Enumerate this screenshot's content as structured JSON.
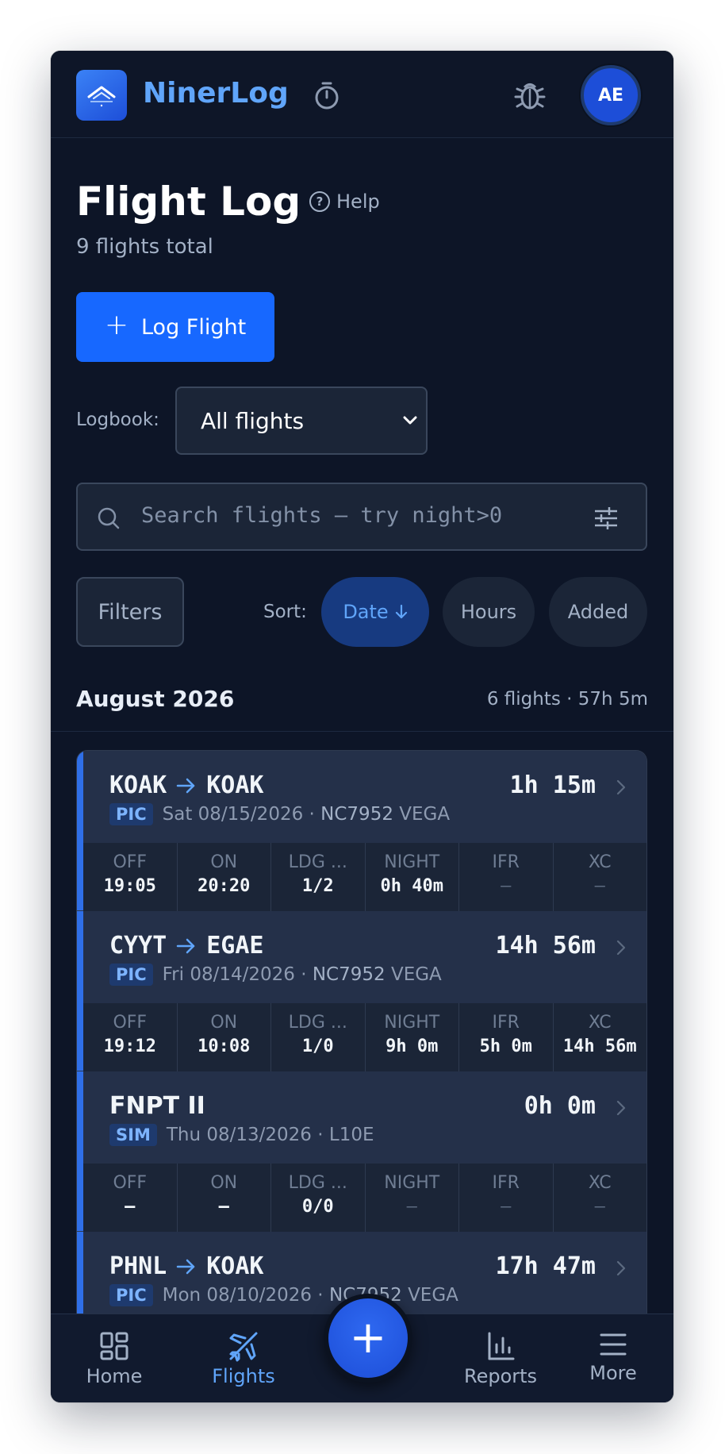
{
  "header": {
    "brand": "NinerLog",
    "avatar_initials": "AE",
    "accent": "#60a5fa",
    "icons": [
      "logo-icon",
      "stopwatch-icon",
      "bug-icon"
    ]
  },
  "page": {
    "title": "Flight Log",
    "help_label": "Help",
    "subtitle": "9 flights total",
    "log_button": "Log Flight",
    "logbook_label": "Logbook:",
    "logbook_selected": "All flights",
    "search_placeholder": "Search flights — try night>0",
    "filters_label": "Filters",
    "sort_label": "Sort:",
    "sort_options": {
      "date": "Date",
      "hours": "Hours",
      "added": "Added"
    }
  },
  "month_group": {
    "label": "August 2026",
    "stats": "6 flights · 57h 5m"
  },
  "flights": [
    {
      "from": "KOAK",
      "to": "KOAK",
      "total": "1h 15m",
      "badge": "PIC",
      "date": "Sat 08/15/2026",
      "tail": "NC7952",
      "type": "VEGA",
      "off": "19:05",
      "on": "20:20",
      "ldg": "1/2",
      "night": "0h 40m",
      "ifr": "—",
      "xc": "—"
    },
    {
      "from": "CYYT",
      "to": "EGAE",
      "total": "14h 56m",
      "badge": "PIC",
      "date": "Fri 08/14/2026",
      "tail": "NC7952",
      "type": "VEGA",
      "off": "19:12",
      "on": "10:08",
      "ldg": "1/0",
      "night": "9h 0m",
      "ifr": "5h 0m",
      "xc": "14h 56m"
    },
    {
      "name": "FNPT II",
      "total": "0h 0m",
      "badge": "SIM",
      "date": "Thu 08/13/2026",
      "device": "L10E",
      "off": "—",
      "on": "—",
      "ldg": "0/0",
      "night": "—",
      "ifr": "—",
      "xc": "—"
    },
    {
      "from": "PHNL",
      "to": "KOAK",
      "total": "17h 47m",
      "badge": "PIC",
      "date": "Mon 08/10/2026",
      "tail": "NC7952",
      "type": "VEGA"
    }
  ],
  "stat_labels": {
    "off": "OFF",
    "on": "ON",
    "ldg": "LDG ...",
    "night": "NIGHT",
    "ifr": "IFR",
    "xc": "XC"
  },
  "nav": {
    "home": "Home",
    "flights": "Flights",
    "reports": "Reports",
    "more": "More",
    "fab": "+"
  }
}
